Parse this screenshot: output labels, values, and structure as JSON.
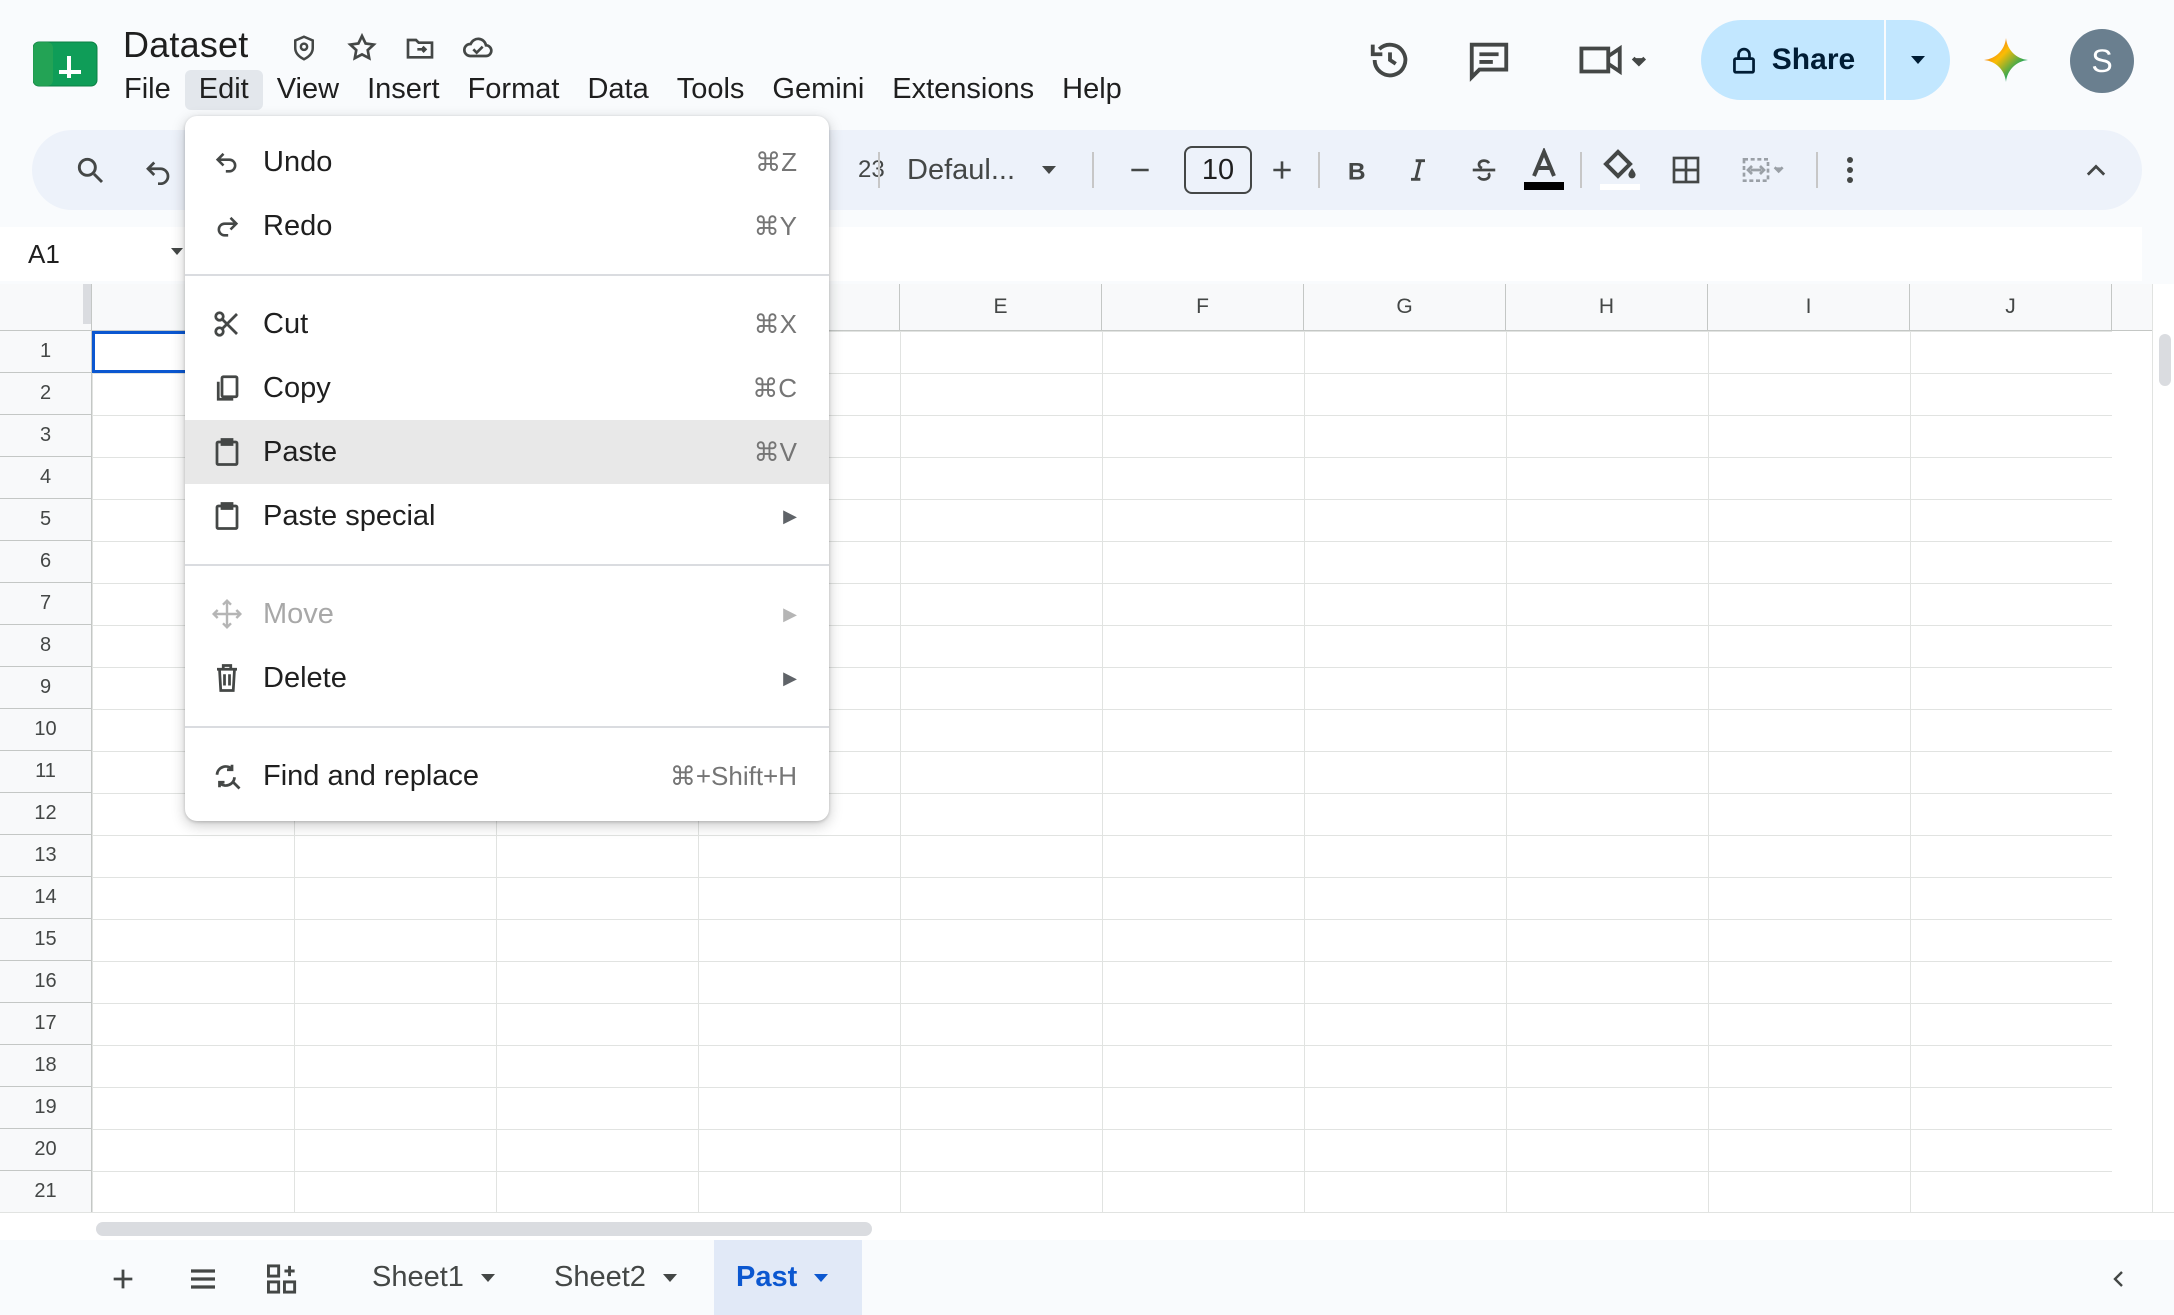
{
  "doc": {
    "title": "Dataset"
  },
  "menubar": [
    "File",
    "Edit",
    "View",
    "Insert",
    "Format",
    "Data",
    "Tools",
    "Gemini",
    "Extensions",
    "Help"
  ],
  "share": {
    "label": "Share"
  },
  "avatar": {
    "initial": "S"
  },
  "toolbar": {
    "number_fragment": "23",
    "font": "Defaul...",
    "font_size": "10"
  },
  "namebox": {
    "value": "A1"
  },
  "columns": [
    "E",
    "F",
    "G",
    "H",
    "I",
    "J"
  ],
  "rows": [
    "1",
    "2",
    "3",
    "4",
    "5",
    "6",
    "7",
    "8",
    "9",
    "10",
    "11",
    "12",
    "13",
    "14",
    "15",
    "16",
    "17",
    "18",
    "19",
    "20",
    "21"
  ],
  "sheets": [
    {
      "name": "Sheet1",
      "active": false
    },
    {
      "name": "Sheet2",
      "active": false
    },
    {
      "name": "Past",
      "active": true
    }
  ],
  "edit_menu": {
    "items": [
      {
        "label": "Undo",
        "shortcut": "⌘Z",
        "icon": "undo-icon"
      },
      {
        "label": "Redo",
        "shortcut": "⌘Y",
        "icon": "redo-icon"
      },
      {
        "label": "Cut",
        "shortcut": "⌘X",
        "icon": "scissors-icon"
      },
      {
        "label": "Copy",
        "shortcut": "⌘C",
        "icon": "copy-icon"
      },
      {
        "label": "Paste",
        "shortcut": "⌘V",
        "icon": "clipboard-icon",
        "highlighted": true
      },
      {
        "label": "Paste special",
        "shortcut": "",
        "icon": "clipboard-icon",
        "submenu": true
      },
      {
        "label": "Move",
        "shortcut": "",
        "icon": "move-icon",
        "submenu": true,
        "disabled": true
      },
      {
        "label": "Delete",
        "shortcut": "",
        "icon": "trash-icon",
        "submenu": true
      },
      {
        "label": "Find and replace",
        "shortcut": "⌘+Shift+H",
        "icon": "find-replace-icon"
      }
    ],
    "submenu_arrow": "▶"
  },
  "colors": {
    "accent": "#0b57d0",
    "share_bg": "#c2e7ff",
    "toolbar_bg": "#edf2fa",
    "menu_highlight": "#e8e8e8"
  }
}
